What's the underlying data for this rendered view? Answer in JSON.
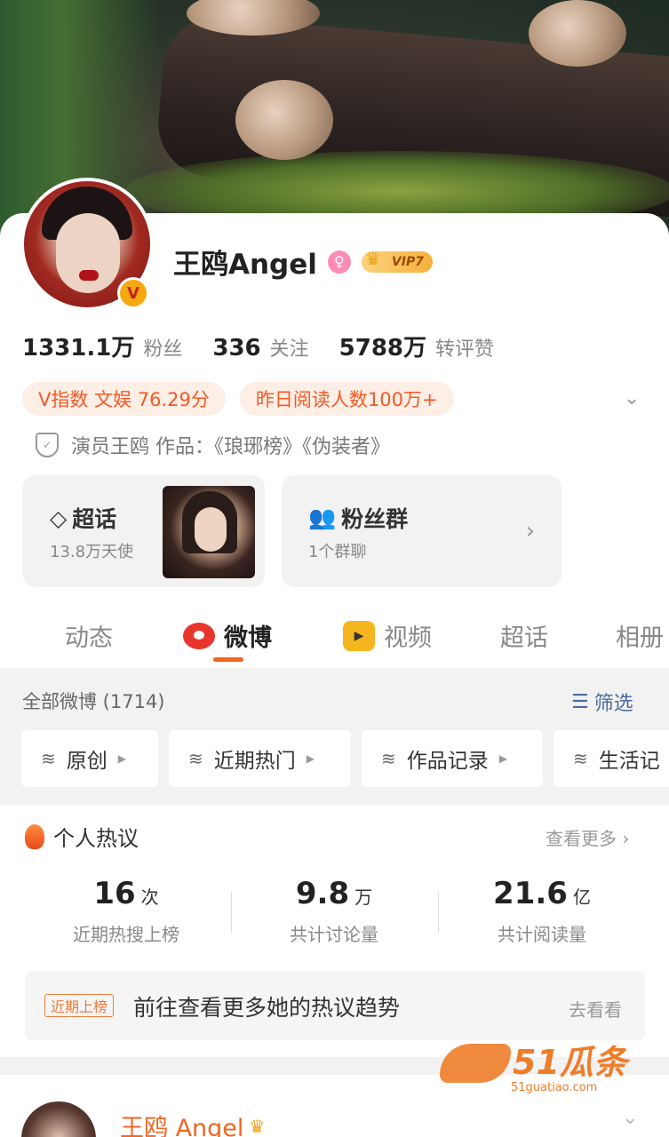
{
  "profile": {
    "name": "王鸥Angel",
    "vip_label": "VIP7",
    "verified_badge": "V",
    "stats": [
      {
        "value": "1331.1万",
        "label": "粉丝"
      },
      {
        "value": "336",
        "label": "关注"
      },
      {
        "value": "5788万",
        "label": "转评赞"
      }
    ],
    "pills": [
      "V指数 文娱 76.29分",
      "昨日阅读人数100万+"
    ],
    "occupation": "演员王鸥 作品：《琅琊榜》《伪装者》"
  },
  "boxes": {
    "super_topic": {
      "title": "超话",
      "sub": "13.8万天使"
    },
    "fan_group": {
      "title": "粉丝群",
      "sub": "1个群聊"
    }
  },
  "tabs": [
    "动态",
    "微博",
    "视频",
    "超话",
    "相册"
  ],
  "active_tab": "微博",
  "feed": {
    "header": "全部微博 (1714)",
    "filter_label": "筛选",
    "chips": [
      "原创",
      "近期热门",
      "作品记录",
      "生活记"
    ]
  },
  "hot": {
    "title": "个人热议",
    "more": "查看更多",
    "metrics": [
      {
        "num": "16",
        "unit": "次",
        "label": "近期热搜上榜"
      },
      {
        "num": "9.8",
        "unit": "万",
        "label": "共计讨论量"
      },
      {
        "num": "21.6",
        "unit": "亿",
        "label": "共计阅读量"
      }
    ],
    "banner_tag": "近期上榜",
    "banner_msg": "前往查看更多她的热议趋势",
    "banner_go": "去看看"
  },
  "post": {
    "author": "王鸥 Angel"
  },
  "watermark": {
    "text": "51瓜条",
    "url": "51guatiao.com"
  },
  "colors": {
    "accent": "#f26522",
    "link": "#4a6c9a",
    "pill_bg": "#fdeee6"
  },
  "icons": [
    "female-icon",
    "vip-crown-icon",
    "shield-icon",
    "diamond-icon",
    "group-icon",
    "weibo-icon",
    "video-icon",
    "filter-icon",
    "layers-icon",
    "flame-icon",
    "chevron-right-icon",
    "chevron-down-icon"
  ]
}
